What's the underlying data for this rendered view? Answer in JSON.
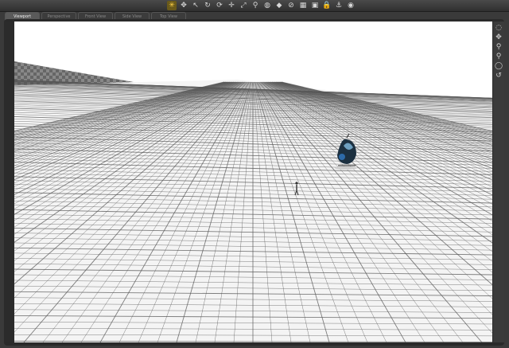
{
  "tabs": [
    {
      "label": "Viewport"
    },
    {
      "label": "Perspective"
    },
    {
      "label": "Front View"
    },
    {
      "label": "Side View"
    },
    {
      "label": "Top View"
    }
  ],
  "toolbar_icons": [
    {
      "name": "universal-tool-icon",
      "glyph": "✳"
    },
    {
      "name": "move-icon",
      "glyph": "✥"
    },
    {
      "name": "select-icon",
      "glyph": "↖"
    },
    {
      "name": "rotate-icon",
      "glyph": "↻"
    },
    {
      "name": "rotate-alt-icon",
      "glyph": "⟳"
    },
    {
      "name": "translate-icon",
      "glyph": "✛"
    },
    {
      "name": "scale-icon",
      "glyph": "⤢"
    },
    {
      "name": "joint-editor-icon",
      "glyph": "⚲"
    },
    {
      "name": "surface-icon",
      "glyph": "◍"
    },
    {
      "name": "geometry-icon",
      "glyph": "◆"
    },
    {
      "name": "node-weight-icon",
      "glyph": "⊘"
    },
    {
      "name": "region-icon",
      "glyph": "▦"
    },
    {
      "name": "spot-render-icon",
      "glyph": "▣"
    },
    {
      "name": "lock-icon",
      "glyph": "🔒"
    },
    {
      "name": "pin-icon",
      "glyph": "⚓"
    },
    {
      "name": "camera-icon",
      "glyph": "◉"
    }
  ],
  "right_tools": [
    {
      "name": "orbit-icon",
      "glyph": "◌"
    },
    {
      "name": "pan-icon",
      "glyph": "✥"
    },
    {
      "name": "zoom-icon",
      "glyph": "⚲"
    },
    {
      "name": "dolly-icon",
      "glyph": "⚲"
    },
    {
      "name": "frame-icon",
      "glyph": "◯"
    },
    {
      "name": "reset-view-icon",
      "glyph": "↺"
    }
  ],
  "colors": {
    "accent": "#ffd24a",
    "ground": "#f4f4f4",
    "grid_line": "#555555",
    "sky": "#ffffff"
  }
}
